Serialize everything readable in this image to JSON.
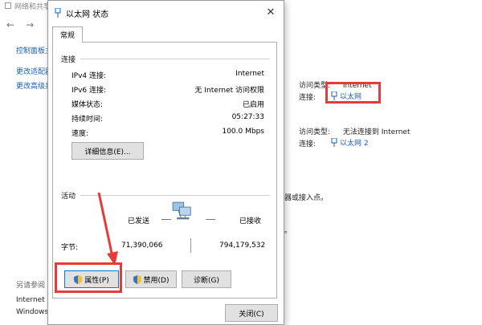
{
  "background": {
    "window_title": "网络和共享中心",
    "nav_back": "←",
    "nav_forward": "→",
    "left_links": [
      "控制面板主",
      "更改适配器",
      "更改高级共"
    ],
    "see_also_title": "另请参阅",
    "see_also_items": [
      "Internet 选",
      "Windows D"
    ],
    "conn1": {
      "access_label": "访问类型:",
      "access_value": "Internet",
      "conn_label": "连接:",
      "conn_value": "以太网"
    },
    "conn2": {
      "access_label": "访问类型:",
      "access_value": "无法连接到 Internet",
      "conn_label": "连接:",
      "conn_value": "以太网 2"
    },
    "fragments": [
      "器或接入点。",
      "。"
    ]
  },
  "dialog": {
    "title": "以太网 状态",
    "tab": "常规",
    "connection_header": "连接",
    "rows": [
      {
        "label": "IPv4 连接:",
        "value": "Internet"
      },
      {
        "label": "IPv6 连接:",
        "value": "无 Internet 访问权限"
      },
      {
        "label": "媒体状态:",
        "value": "已启用"
      },
      {
        "label": "持续时间:",
        "value": "05:27:33"
      },
      {
        "label": "速度:",
        "value": "100.0 Mbps"
      }
    ],
    "details_button": "详细信息(E)...",
    "activity_header": "活动",
    "sent_label": "已发送",
    "received_label": "已接收",
    "bytes_label": "字节:",
    "bytes_sent": "71,390,066",
    "bytes_received": "794,179,532",
    "properties_button": "属性(P)",
    "disable_button": "禁用(D)",
    "diagnose_button": "诊断(G)",
    "close_button": "关闭(C)"
  },
  "colors": {
    "highlight": "#e83a3a",
    "link": "#1a5fb4",
    "focus_border": "#0078d7"
  }
}
